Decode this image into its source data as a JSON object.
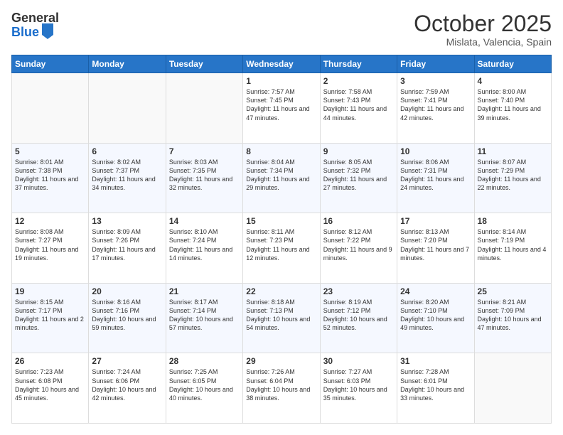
{
  "header": {
    "logo_general": "General",
    "logo_blue": "Blue",
    "month": "October 2025",
    "location": "Mislata, Valencia, Spain"
  },
  "weekdays": [
    "Sunday",
    "Monday",
    "Tuesday",
    "Wednesday",
    "Thursday",
    "Friday",
    "Saturday"
  ],
  "weeks": [
    [
      {
        "day": "",
        "info": ""
      },
      {
        "day": "",
        "info": ""
      },
      {
        "day": "",
        "info": ""
      },
      {
        "day": "1",
        "info": "Sunrise: 7:57 AM\nSunset: 7:45 PM\nDaylight: 11 hours and 47 minutes."
      },
      {
        "day": "2",
        "info": "Sunrise: 7:58 AM\nSunset: 7:43 PM\nDaylight: 11 hours and 44 minutes."
      },
      {
        "day": "3",
        "info": "Sunrise: 7:59 AM\nSunset: 7:41 PM\nDaylight: 11 hours and 42 minutes."
      },
      {
        "day": "4",
        "info": "Sunrise: 8:00 AM\nSunset: 7:40 PM\nDaylight: 11 hours and 39 minutes."
      }
    ],
    [
      {
        "day": "5",
        "info": "Sunrise: 8:01 AM\nSunset: 7:38 PM\nDaylight: 11 hours and 37 minutes."
      },
      {
        "day": "6",
        "info": "Sunrise: 8:02 AM\nSunset: 7:37 PM\nDaylight: 11 hours and 34 minutes."
      },
      {
        "day": "7",
        "info": "Sunrise: 8:03 AM\nSunset: 7:35 PM\nDaylight: 11 hours and 32 minutes."
      },
      {
        "day": "8",
        "info": "Sunrise: 8:04 AM\nSunset: 7:34 PM\nDaylight: 11 hours and 29 minutes."
      },
      {
        "day": "9",
        "info": "Sunrise: 8:05 AM\nSunset: 7:32 PM\nDaylight: 11 hours and 27 minutes."
      },
      {
        "day": "10",
        "info": "Sunrise: 8:06 AM\nSunset: 7:31 PM\nDaylight: 11 hours and 24 minutes."
      },
      {
        "day": "11",
        "info": "Sunrise: 8:07 AM\nSunset: 7:29 PM\nDaylight: 11 hours and 22 minutes."
      }
    ],
    [
      {
        "day": "12",
        "info": "Sunrise: 8:08 AM\nSunset: 7:27 PM\nDaylight: 11 hours and 19 minutes."
      },
      {
        "day": "13",
        "info": "Sunrise: 8:09 AM\nSunset: 7:26 PM\nDaylight: 11 hours and 17 minutes."
      },
      {
        "day": "14",
        "info": "Sunrise: 8:10 AM\nSunset: 7:24 PM\nDaylight: 11 hours and 14 minutes."
      },
      {
        "day": "15",
        "info": "Sunrise: 8:11 AM\nSunset: 7:23 PM\nDaylight: 11 hours and 12 minutes."
      },
      {
        "day": "16",
        "info": "Sunrise: 8:12 AM\nSunset: 7:22 PM\nDaylight: 11 hours and 9 minutes."
      },
      {
        "day": "17",
        "info": "Sunrise: 8:13 AM\nSunset: 7:20 PM\nDaylight: 11 hours and 7 minutes."
      },
      {
        "day": "18",
        "info": "Sunrise: 8:14 AM\nSunset: 7:19 PM\nDaylight: 11 hours and 4 minutes."
      }
    ],
    [
      {
        "day": "19",
        "info": "Sunrise: 8:15 AM\nSunset: 7:17 PM\nDaylight: 11 hours and 2 minutes."
      },
      {
        "day": "20",
        "info": "Sunrise: 8:16 AM\nSunset: 7:16 PM\nDaylight: 10 hours and 59 minutes."
      },
      {
        "day": "21",
        "info": "Sunrise: 8:17 AM\nSunset: 7:14 PM\nDaylight: 10 hours and 57 minutes."
      },
      {
        "day": "22",
        "info": "Sunrise: 8:18 AM\nSunset: 7:13 PM\nDaylight: 10 hours and 54 minutes."
      },
      {
        "day": "23",
        "info": "Sunrise: 8:19 AM\nSunset: 7:12 PM\nDaylight: 10 hours and 52 minutes."
      },
      {
        "day": "24",
        "info": "Sunrise: 8:20 AM\nSunset: 7:10 PM\nDaylight: 10 hours and 49 minutes."
      },
      {
        "day": "25",
        "info": "Sunrise: 8:21 AM\nSunset: 7:09 PM\nDaylight: 10 hours and 47 minutes."
      }
    ],
    [
      {
        "day": "26",
        "info": "Sunrise: 7:23 AM\nSunset: 6:08 PM\nDaylight: 10 hours and 45 minutes."
      },
      {
        "day": "27",
        "info": "Sunrise: 7:24 AM\nSunset: 6:06 PM\nDaylight: 10 hours and 42 minutes."
      },
      {
        "day": "28",
        "info": "Sunrise: 7:25 AM\nSunset: 6:05 PM\nDaylight: 10 hours and 40 minutes."
      },
      {
        "day": "29",
        "info": "Sunrise: 7:26 AM\nSunset: 6:04 PM\nDaylight: 10 hours and 38 minutes."
      },
      {
        "day": "30",
        "info": "Sunrise: 7:27 AM\nSunset: 6:03 PM\nDaylight: 10 hours and 35 minutes."
      },
      {
        "day": "31",
        "info": "Sunrise: 7:28 AM\nSunset: 6:01 PM\nDaylight: 10 hours and 33 minutes."
      },
      {
        "day": "",
        "info": ""
      }
    ]
  ]
}
